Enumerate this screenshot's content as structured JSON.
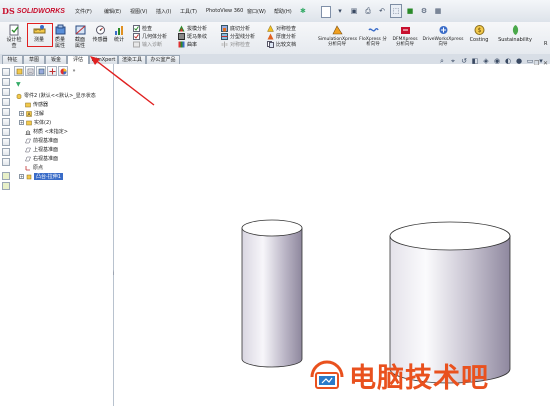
{
  "app": {
    "logo_ds": "DS",
    "logo_name": "SOLIDWORKS"
  },
  "menu": [
    "文件(F)",
    "编辑(E)",
    "视图(V)",
    "插入(I)",
    "工具(T)",
    "PhotoView 360",
    "窗口(W)",
    "帮助(H)"
  ],
  "ribbon": {
    "design_check": "设计检查",
    "measure": "测量",
    "mass_properties": "质量属性",
    "section_properties": "截面属性",
    "sensors": "传感器",
    "statistics": "统计",
    "check": "检查",
    "geometry_analysis": "几何体分析",
    "import_diagnostics": "输入诊断",
    "draft_analysis": "拔模分析",
    "zebra_stripes": "斑马条纹",
    "curvature": "曲率",
    "undercut_analysis": "底切分析",
    "parting_line_analysis": "分型线分析",
    "symmetry_check": "对称检查",
    "thickness_analysis": "厚度分析",
    "compare_documents": "比较文档",
    "simulationxpress": "SimulationXpress 分析向导",
    "floxpress": "FloXpress 分析向导",
    "dfmxpress": "DFMXpress 分析向导",
    "driveworksxpress": "DriveWorksXpress 向导",
    "costing": "Costing",
    "sustainability": "Sustainability",
    "overflow": "R"
  },
  "tabs": [
    "特征",
    "草图",
    "钣金",
    "评估",
    "DimXpert",
    "渲染工具",
    "办公室产品"
  ],
  "active_tab": "评估",
  "tree": {
    "root": "零件2 (默认<<默认>_显示状态",
    "items": [
      "传感器",
      "注解",
      "实体(2)",
      "材质 <未指定>",
      "前视基准面",
      "上视基准面",
      "右视基准面",
      "原点",
      "凸台-拉伸1"
    ]
  },
  "watermark": "电脑技术吧",
  "colors": {
    "highlight": "#e02020",
    "watermark": "#e9511e",
    "selection": "#3a6cc8"
  }
}
